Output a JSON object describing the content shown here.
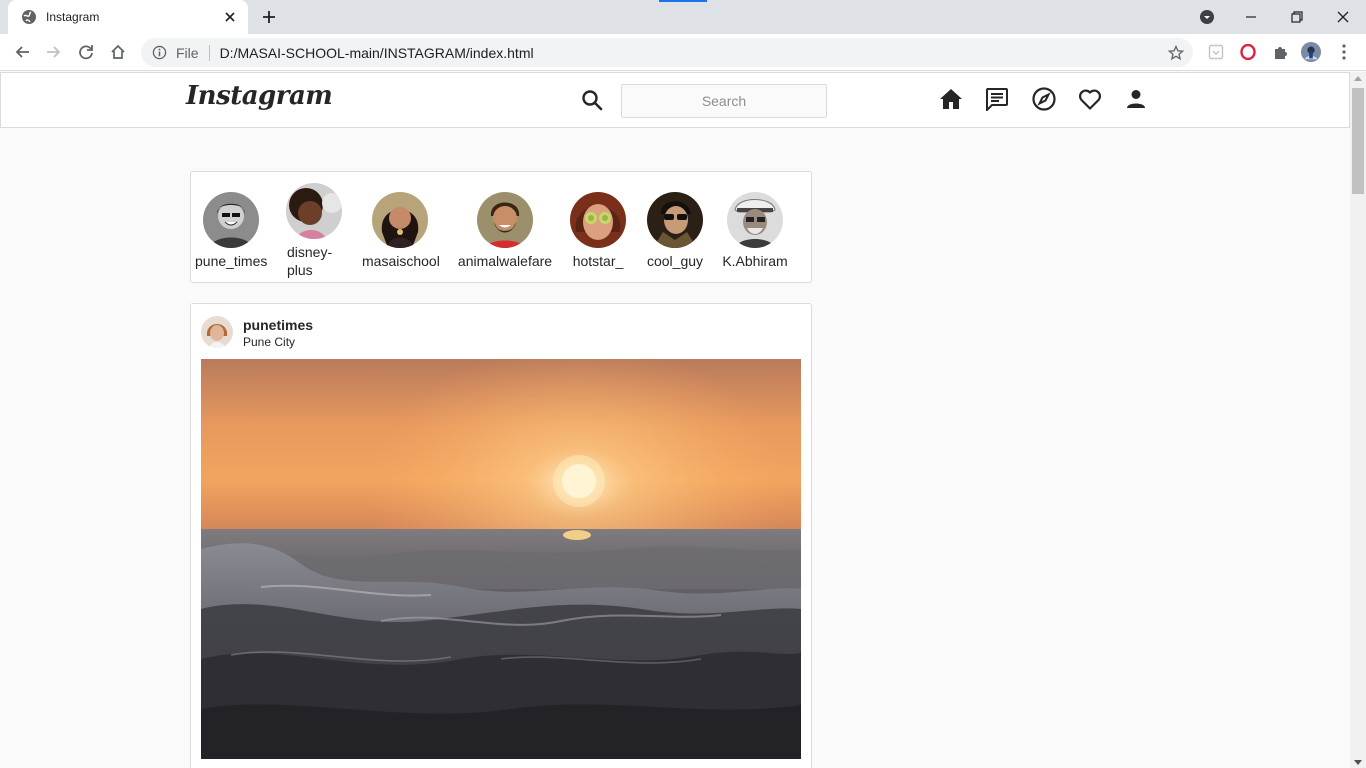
{
  "browser": {
    "tab_title": "Instagram",
    "omnibox_scheme": "File",
    "omnibox_url": "D:/MASAI-SCHOOL-main/INSTAGRAM/index.html"
  },
  "page": {
    "logo": "Instagram",
    "search_placeholder": "Search",
    "stories": [
      {
        "name": "pune_times"
      },
      {
        "name": "disney-plus"
      },
      {
        "name": "masaischool"
      },
      {
        "name": "animalwalefare"
      },
      {
        "name": "hotstar_"
      },
      {
        "name": "cool_guy"
      },
      {
        "name": "K.Abhiram"
      }
    ],
    "post": {
      "username": "punetimes",
      "location": "Pune City"
    }
  }
}
